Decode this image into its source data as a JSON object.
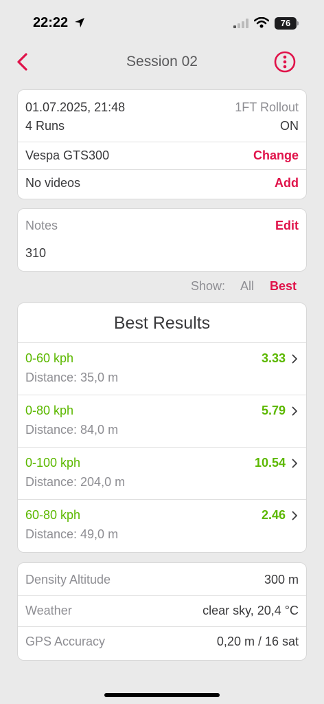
{
  "status": {
    "time": "22:22",
    "battery": "76"
  },
  "nav": {
    "title": "Session 02"
  },
  "session": {
    "datetime": "01.07.2025, 21:48",
    "runs": "4 Runs",
    "rollout_label": "1FT Rollout",
    "rollout_value": "ON",
    "vehicle": "Vespa GTS300",
    "vehicle_action": "Change",
    "videos": "No videos",
    "videos_action": "Add"
  },
  "notes": {
    "label": "Notes",
    "action": "Edit",
    "text": "310"
  },
  "filter": {
    "label": "Show:",
    "all": "All",
    "best": "Best",
    "selected": "Best"
  },
  "best": {
    "title": "Best Results",
    "results": [
      {
        "name": "0-60 kph",
        "distance": "Distance: 35,0 m",
        "time": "3.33"
      },
      {
        "name": "0-80 kph",
        "distance": "Distance: 84,0 m",
        "time": "5.79"
      },
      {
        "name": "0-100 kph",
        "distance": "Distance: 204,0 m",
        "time": "10.54"
      },
      {
        "name": "60-80 kph",
        "distance": "Distance: 49,0 m",
        "time": "2.46"
      }
    ]
  },
  "conditions": {
    "density_label": "Density Altitude",
    "density_value": "300 m",
    "weather_label": "Weather",
    "weather_value": "clear sky, 20,4 °C",
    "gps_label": "GPS Accuracy",
    "gps_value": "0,20 m / 16 sat"
  },
  "colors": {
    "accent": "#e0134a",
    "green": "#5cb800",
    "background": "#eaeaea"
  },
  "icons": [
    "location-arrow-icon",
    "signal-icon",
    "wifi-icon",
    "battery-icon",
    "back-chevron-icon",
    "more-options-icon",
    "chevron-right-icon"
  ]
}
